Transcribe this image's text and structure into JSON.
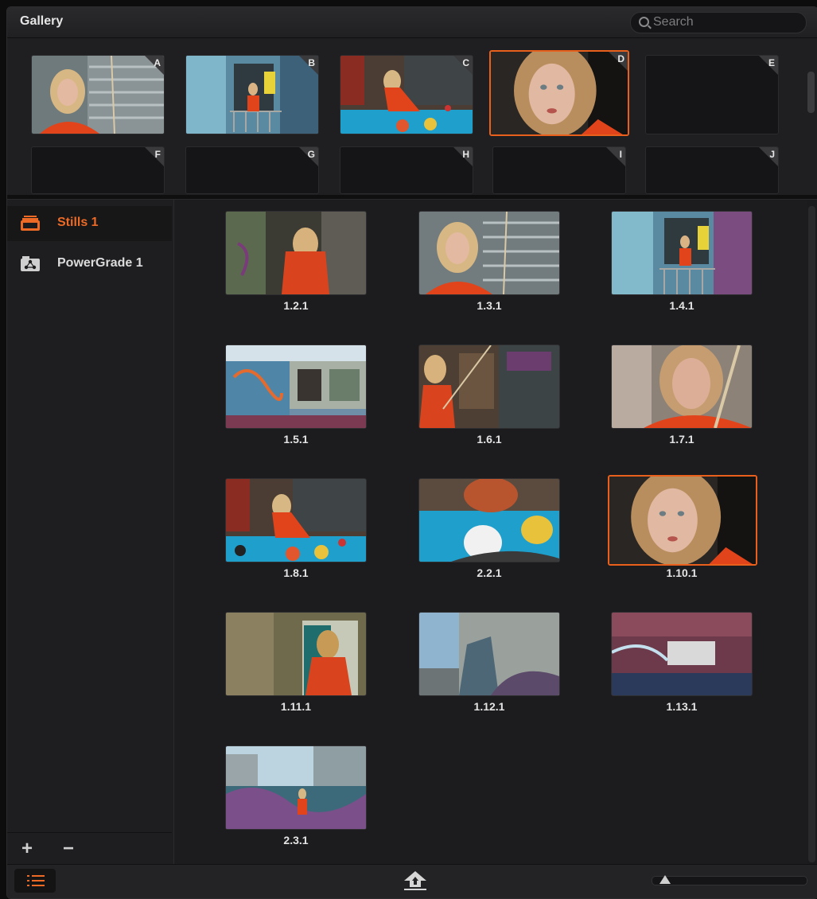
{
  "gallery": {
    "title": "Gallery"
  },
  "search": {
    "placeholder": "Search"
  },
  "memories": [
    {
      "label": "A",
      "filled": true
    },
    {
      "label": "B",
      "filled": true
    },
    {
      "label": "C",
      "filled": true
    },
    {
      "label": "D",
      "filled": true,
      "selected": true
    },
    {
      "label": "E",
      "filled": false
    },
    {
      "label": "F",
      "filled": false
    },
    {
      "label": "G",
      "filled": false
    },
    {
      "label": "H",
      "filled": false
    },
    {
      "label": "I",
      "filled": false
    },
    {
      "label": "J",
      "filled": false
    }
  ],
  "albums": [
    {
      "label": "Stills 1",
      "selected": true,
      "icon": "stills-album-icon"
    },
    {
      "label": "PowerGrade 1",
      "selected": false,
      "icon": "powergrade-album-icon"
    }
  ],
  "sidebar_controls": {
    "add": "+",
    "remove": "−"
  },
  "stills": [
    {
      "label": "1.2.1"
    },
    {
      "label": "1.3.1"
    },
    {
      "label": "1.4.1"
    },
    {
      "label": "1.5.1"
    },
    {
      "label": "1.6.1"
    },
    {
      "label": "1.7.1"
    },
    {
      "label": "1.8.1"
    },
    {
      "label": "2.2.1"
    },
    {
      "label": "1.10.1",
      "selected": true
    },
    {
      "label": "1.11.1"
    },
    {
      "label": "1.12.1"
    },
    {
      "label": "1.13.1"
    },
    {
      "label": "2.3.1"
    }
  ],
  "colors": {
    "accent": "#e8601c",
    "background": "#1c1c1e"
  },
  "bottom_bar": {
    "list_view_icon": "list-view-icon",
    "export_icon": "export-icon",
    "zoom_level": 0.05
  }
}
